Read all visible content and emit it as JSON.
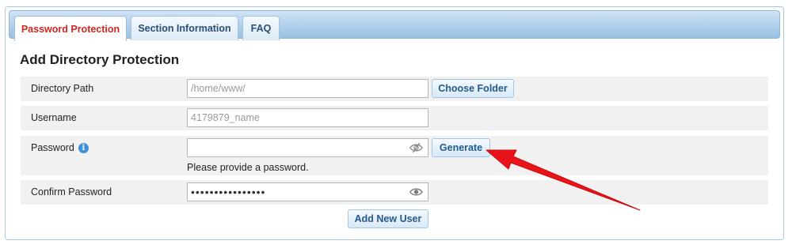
{
  "tabs": [
    {
      "label": "Password Protection",
      "active": true
    },
    {
      "label": "Section Information",
      "active": false
    },
    {
      "label": "FAQ",
      "active": false
    }
  ],
  "form": {
    "heading": "Add Directory Protection",
    "directory_path": {
      "label": "Directory Path",
      "value": "/home/www/"
    },
    "choose_folder_label": "Choose Folder",
    "username": {
      "label": "Username",
      "placeholder": "4179879_name"
    },
    "password": {
      "label": "Password",
      "value": "",
      "hint": "Please provide a password."
    },
    "generate_label": "Generate",
    "confirm_password": {
      "label": "Confirm Password",
      "value": "••••••••••••••••"
    },
    "add_user_label": "Add New User"
  },
  "icons": {
    "info": "info-icon",
    "password_hidden": "eye-slash-icon",
    "password_visible": "eye-icon"
  },
  "colors": {
    "active_tab_text": "#d4251e",
    "button_text": "#24598f",
    "annotation_arrow": "#e8141a"
  }
}
